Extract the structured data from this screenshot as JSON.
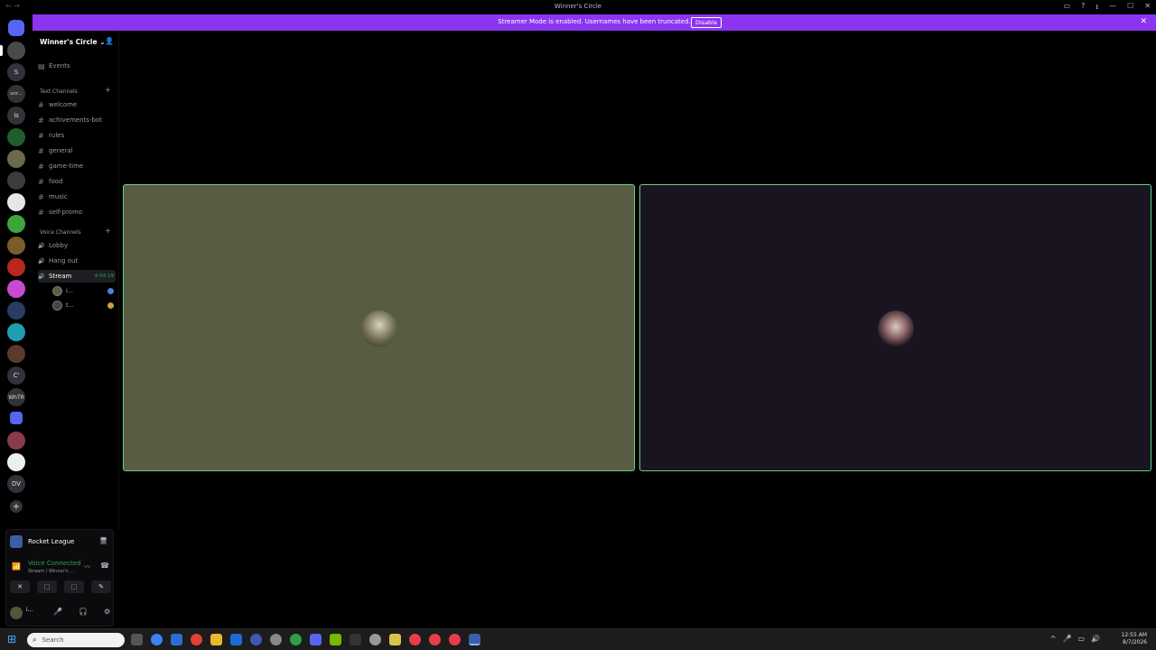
{
  "window": {
    "title": "Winner's Circle",
    "nav_glyph": "← →",
    "controls": [
      "▭",
      "?",
      "⭳",
      "—",
      "☐",
      "✕"
    ]
  },
  "banner": {
    "message": "Streamer Mode is enabled. Usernames have been truncated.",
    "disable_label": "Disable",
    "close_glyph": "✕"
  },
  "rail": {
    "servers": [
      "",
      "",
      "S",
      "unr…",
      "is",
      "",
      "",
      "",
      "",
      "",
      "",
      "",
      "",
      "",
      "",
      "",
      "",
      "C'",
      "WhTR",
      "",
      "",
      "",
      "DV",
      "+"
    ]
  },
  "sidebar": {
    "server_name": "Winner's Circle",
    "server_chevron": "⌄",
    "invite_glyph": "👤",
    "events_label": "Events",
    "text_category": "Text Channels",
    "text_channels": [
      "welcome",
      "achivements-bot",
      "rules",
      "general",
      "game-time",
      "food",
      "music",
      "self-promo"
    ],
    "voice_category": "Voice Channels",
    "voice_channels": [
      "Lobby",
      "Hang out",
      "Stream"
    ],
    "stream_timer": "4:54:19",
    "voice_users": [
      "i...",
      "t..."
    ],
    "hash_glyph": "#",
    "speaker_glyph": "🔊",
    "add_glyph": "+"
  },
  "panel": {
    "game_name": "Rocket League",
    "game_action_glyph": "🖥",
    "voice_status": "Voice Connected",
    "voice_sub": "Stream / Winner's ...",
    "signal_glyph": "📶",
    "wave_glyph": "〰",
    "hang_glyph": "☎",
    "actions": [
      "✕",
      "⬚",
      "⬚",
      "✎"
    ],
    "username": "i...",
    "mic_glyph": "🎤",
    "headset_glyph": "🎧",
    "settings_glyph": "⚙"
  },
  "taskbar": {
    "search_placeholder": "Search",
    "start_glyph": "⊞",
    "search_glyph": "⌕",
    "tray_icons": [
      "^",
      "🎤",
      "▭",
      "🔊"
    ],
    "time": "12:55 AM",
    "date": "8/7/2026"
  },
  "colors": {
    "banner": "#8b35f0",
    "tile_left": "#585c42",
    "tile_right": "#1a1420",
    "speaking_border": "#5fd48a",
    "voice_green": "#23a55a"
  }
}
